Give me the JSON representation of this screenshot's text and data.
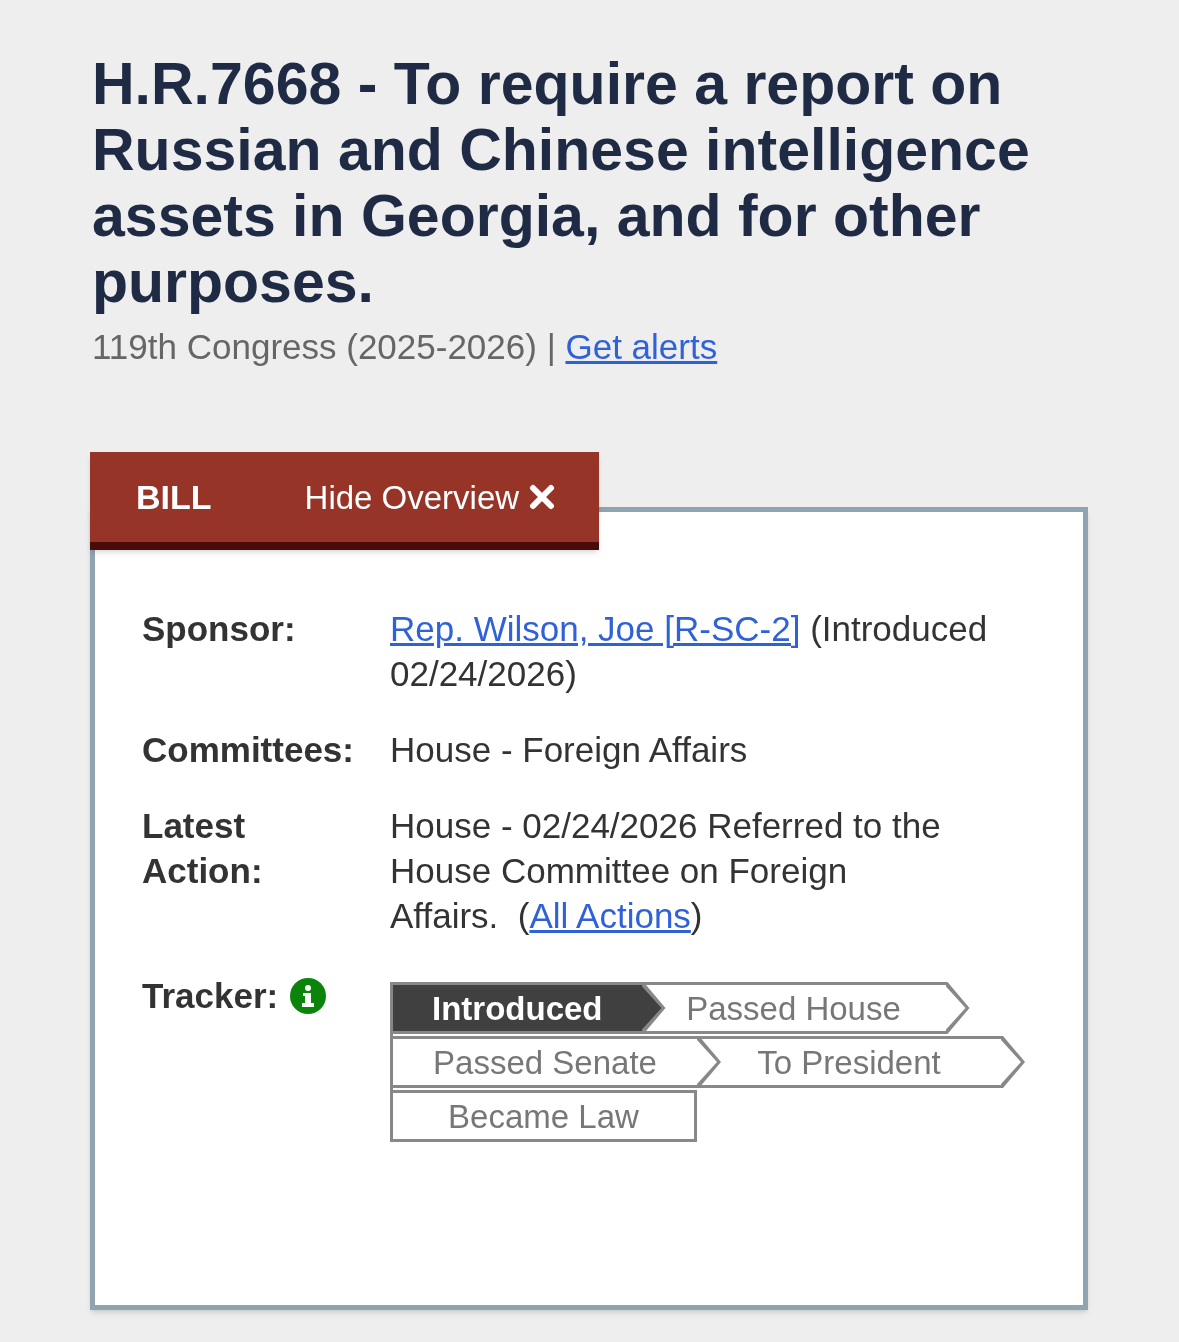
{
  "title": "H.R.7668 - To require a report on Russian and Chinese intelligence assets in Georgia, and for other purposes.",
  "subtitle": {
    "text": "119th Congress (2025-2026) |",
    "link": "Get alerts"
  },
  "overview": {
    "tab_label": "BILL",
    "hide_button": "Hide Overview",
    "details": [
      {
        "label": "Sponsor:",
        "parts": [
          {
            "kind": "link",
            "text": "Rep. Wilson, Joe [R-SC-2]"
          },
          {
            "kind": "text",
            "text": " (Introduced 02/24/2026)"
          }
        ]
      },
      {
        "label": "Committees:",
        "parts": [
          {
            "kind": "text",
            "text": "House - Foreign Affairs"
          }
        ]
      },
      {
        "label": "Latest Action:",
        "parts": [
          {
            "kind": "text",
            "text": "House - 02/24/2026 Referred to the House Committee on Foreign Affairs.  ("
          },
          {
            "kind": "link",
            "text": "All Actions"
          },
          {
            "kind": "text",
            "text": ")"
          }
        ]
      }
    ],
    "tracker": {
      "label": "Tracker:",
      "steps": [
        {
          "label": "Introduced",
          "current": true
        },
        {
          "label": "Passed House",
          "current": false
        },
        {
          "label": "Passed Senate",
          "current": false
        },
        {
          "label": "To President",
          "current": false
        },
        {
          "label": "Became Law",
          "current": false
        }
      ]
    }
  }
}
